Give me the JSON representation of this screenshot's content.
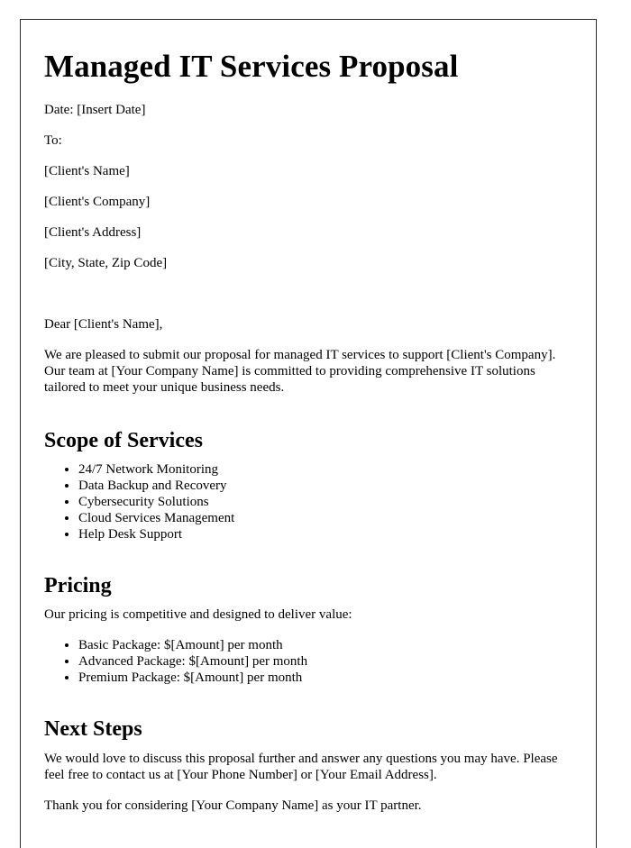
{
  "document": {
    "title": "Managed IT Services Proposal",
    "date_line": "Date: [Insert Date]",
    "recipient_label": "To:",
    "recipient": {
      "name": "[Client's Name]",
      "company": "[Client's Company]",
      "address": "[Client's Address]",
      "city_state_zip": "[City, State, Zip Code]"
    },
    "salutation": "Dear [Client's Name],",
    "intro_paragraph": "We are pleased to submit our proposal for managed IT services to support [Client's Company]. Our team at [Your Company Name] is committed to providing comprehensive IT solutions tailored to meet your unique business needs.",
    "sections": [
      {
        "heading": "Scope of Services",
        "items": [
          "24/7 Network Monitoring",
          "Data Backup and Recovery",
          "Cybersecurity Solutions",
          "Cloud Services Management",
          "Help Desk Support"
        ]
      },
      {
        "heading": "Pricing",
        "lead_in": "Our pricing is competitive and designed to deliver value:",
        "items": [
          "Basic Package: $[Amount] per month",
          "Advanced Package: $[Amount] per month",
          "Premium Package: $[Amount] per month"
        ]
      },
      {
        "heading": "Next Steps",
        "paragraph": "We would love to discuss this proposal further and answer any questions you may have. Please feel free to contact us at [Your Phone Number] or [Your Email Address].",
        "closing": "Thank you for considering [Your Company Name] as your IT partner."
      }
    ],
    "colors": {
      "page_background": "#ffffff",
      "page_border": "#2b2b2b",
      "text": "#000000"
    }
  }
}
